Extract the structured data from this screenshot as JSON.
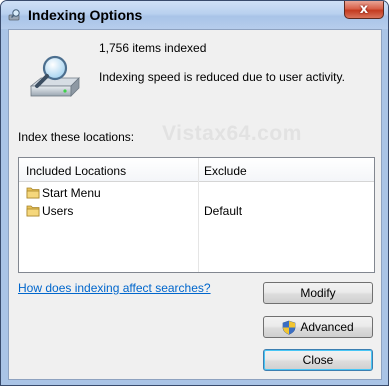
{
  "window": {
    "title": "Indexing Options",
    "close_label": "x"
  },
  "status": {
    "items_indexed": "1,756 items indexed",
    "message": "Indexing speed is reduced due to user activity."
  },
  "watermark": "Vistax64.com",
  "locations": {
    "heading": "Index these locations:",
    "columns": [
      "Included Locations",
      "Exclude"
    ],
    "rows": [
      {
        "name": "Start Menu",
        "exclude": ""
      },
      {
        "name": "Users",
        "exclude": "Default"
      }
    ]
  },
  "help_link": "How does indexing affect searches?",
  "buttons": {
    "modify": "Modify",
    "advanced": "Advanced",
    "close": "Close"
  },
  "icons": {
    "title": "indexing-icon",
    "drive": "drive-magnifier-icon",
    "folder": "folder-icon",
    "shield": "uac-shield-icon"
  }
}
